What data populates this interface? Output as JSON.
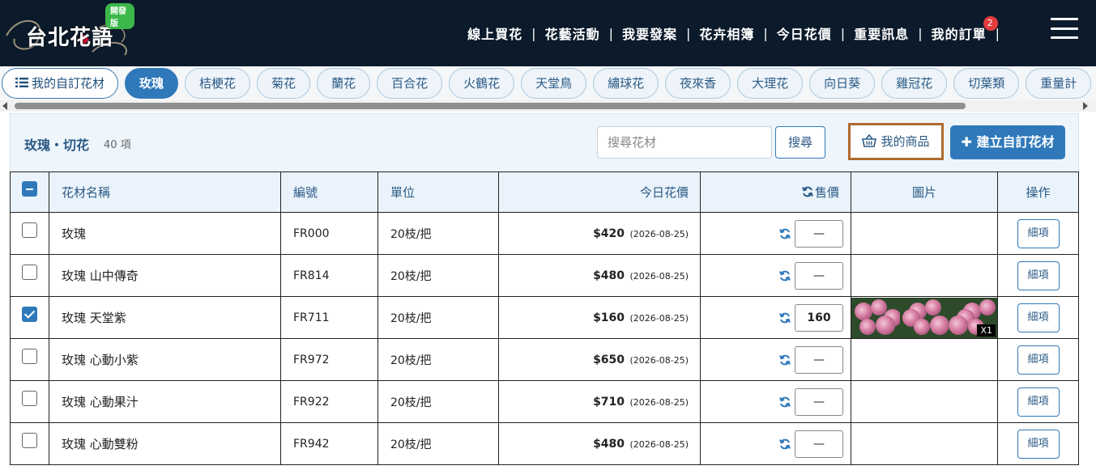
{
  "header": {
    "logo_text": "台北花語",
    "dev_badge": "開發版",
    "nav": [
      {
        "label": "線上買花"
      },
      {
        "label": "花藝活動"
      },
      {
        "label": "我要發案"
      },
      {
        "label": "花卉相簿"
      },
      {
        "label": "今日花價"
      },
      {
        "label": "重要訊息"
      },
      {
        "label": "我的訂單",
        "badge": "2"
      }
    ],
    "separator": "|",
    "menu_icon": "hamburger-menu-icon"
  },
  "categories": [
    {
      "label": "我的自訂花材",
      "icon": "list-icon",
      "style": "custom"
    },
    {
      "label": "玫瑰",
      "style": "active"
    },
    {
      "label": "桔梗花"
    },
    {
      "label": "菊花"
    },
    {
      "label": "蘭花"
    },
    {
      "label": "百合花"
    },
    {
      "label": "火鶴花"
    },
    {
      "label": "天堂鳥"
    },
    {
      "label": "繡球花"
    },
    {
      "label": "夜來香"
    },
    {
      "label": "大理花"
    },
    {
      "label": "向日葵"
    },
    {
      "label": "雞冠花"
    },
    {
      "label": "切葉類"
    },
    {
      "label": "重量計"
    }
  ],
  "panel": {
    "title": "玫瑰・切花",
    "count": "40 項",
    "search_placeholder": "搜尋花材",
    "search_label": "搜尋",
    "my_products_label": "我的商品",
    "create_label": "建立自訂花材"
  },
  "table": {
    "headers": {
      "name": "花材名稱",
      "code": "編號",
      "unit": "單位",
      "price": "今日花價",
      "sale": "售價",
      "image": "圖片",
      "ops": "操作"
    },
    "rows": [
      {
        "checked": false,
        "name": "玫瑰",
        "code": "FR000",
        "unit": "20枝/把",
        "price": "$420",
        "date": "(2026-08-25)",
        "sale": "—",
        "has_image": false,
        "detail": "細項"
      },
      {
        "checked": false,
        "name": "玫瑰 山中傳奇",
        "code": "FR814",
        "unit": "20枝/把",
        "price": "$480",
        "date": "(2026-08-25)",
        "sale": "—",
        "has_image": false,
        "detail": "細項"
      },
      {
        "checked": true,
        "name": "玫瑰 天堂紫",
        "code": "FR711",
        "unit": "20枝/把",
        "price": "$160",
        "date": "(2026-08-25)",
        "sale": "160",
        "has_image": true,
        "image_count": "X1",
        "detail": "細項"
      },
      {
        "checked": false,
        "name": "玫瑰 心動小紫",
        "code": "FR972",
        "unit": "20枝/把",
        "price": "$650",
        "date": "(2026-08-25)",
        "sale": "—",
        "has_image": false,
        "detail": "細項"
      },
      {
        "checked": false,
        "name": "玫瑰 心動果汁",
        "code": "FR922",
        "unit": "20枝/把",
        "price": "$710",
        "date": "(2026-08-25)",
        "sale": "—",
        "has_image": false,
        "detail": "細項"
      },
      {
        "checked": false,
        "name": "玫瑰 心動雙粉",
        "code": "FR942",
        "unit": "20枝/把",
        "price": "$480",
        "date": "(2026-08-25)",
        "sale": "—",
        "has_image": false,
        "detail": "細項"
      }
    ]
  }
}
